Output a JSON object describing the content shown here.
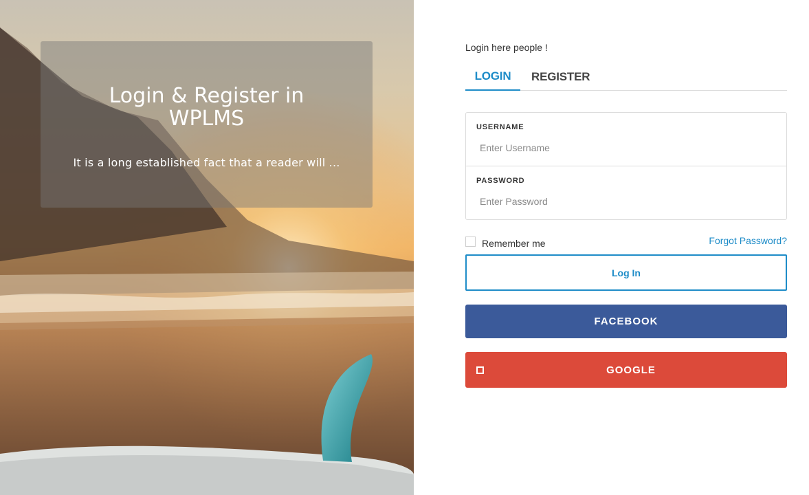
{
  "hero": {
    "title": "Login & Register in WPLMS",
    "text": "It is a long established fact that a reader will ..."
  },
  "form": {
    "intro": "Login here people !",
    "tabs": [
      {
        "label": "LOGIN",
        "active": true
      },
      {
        "label": "REGISTER",
        "active": false
      }
    ],
    "username": {
      "label": "USERNAME",
      "placeholder": "Enter Username",
      "value": ""
    },
    "password": {
      "label": "PASSWORD",
      "placeholder": "Enter Password",
      "value": ""
    },
    "remember_label": "Remember me",
    "remember_checked": false,
    "forgot_label": "Forgot Password?",
    "login_button": "Log In",
    "facebook_button": "FACEBOOK",
    "google_button": "GOOGLE"
  },
  "colors": {
    "accent": "#1e8cc8",
    "facebook": "#3b5a9a",
    "google": "#dc4a3a"
  },
  "icons": {
    "google": "google-icon"
  }
}
